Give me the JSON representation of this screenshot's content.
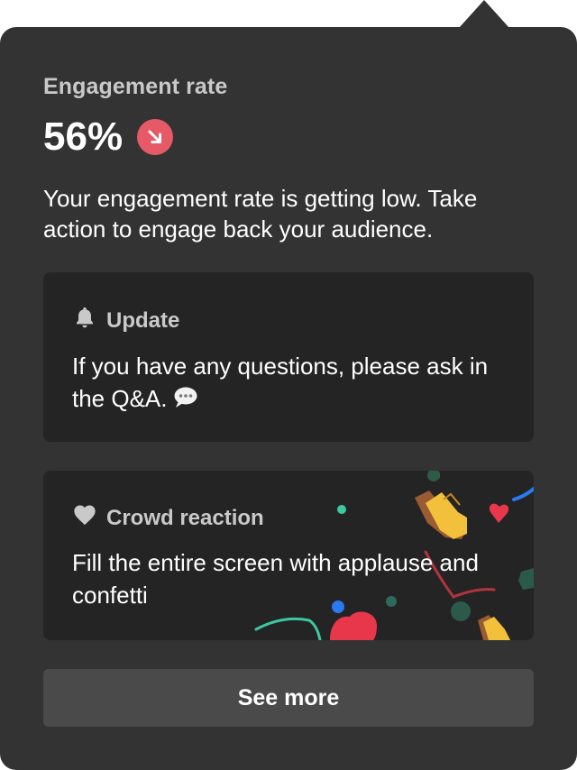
{
  "metric": {
    "title": "Engagement rate",
    "value": "56%",
    "trend_icon": "arrow-down-right-icon",
    "trend_color": "#e65a67"
  },
  "description": "Your engagement rate is getting low. Take action to engage back your audience.",
  "update_card": {
    "icon": "bell-icon",
    "title": "Update",
    "body": "If you have any questions, please ask in the Q&A.",
    "trailing_icon": "speech-bubble-icon"
  },
  "crowd_card": {
    "icon": "heart-icon",
    "title": "Crowd reaction",
    "body": "Fill the entire screen with applause and confetti",
    "decoration": [
      "clapping-hands-icon",
      "heart-icon",
      "confetti"
    ]
  },
  "see_more_label": "See more",
  "colors": {
    "panel": "#333333",
    "card": "#242424",
    "button": "#4a4a4a",
    "accent_red": "#e65a67"
  }
}
